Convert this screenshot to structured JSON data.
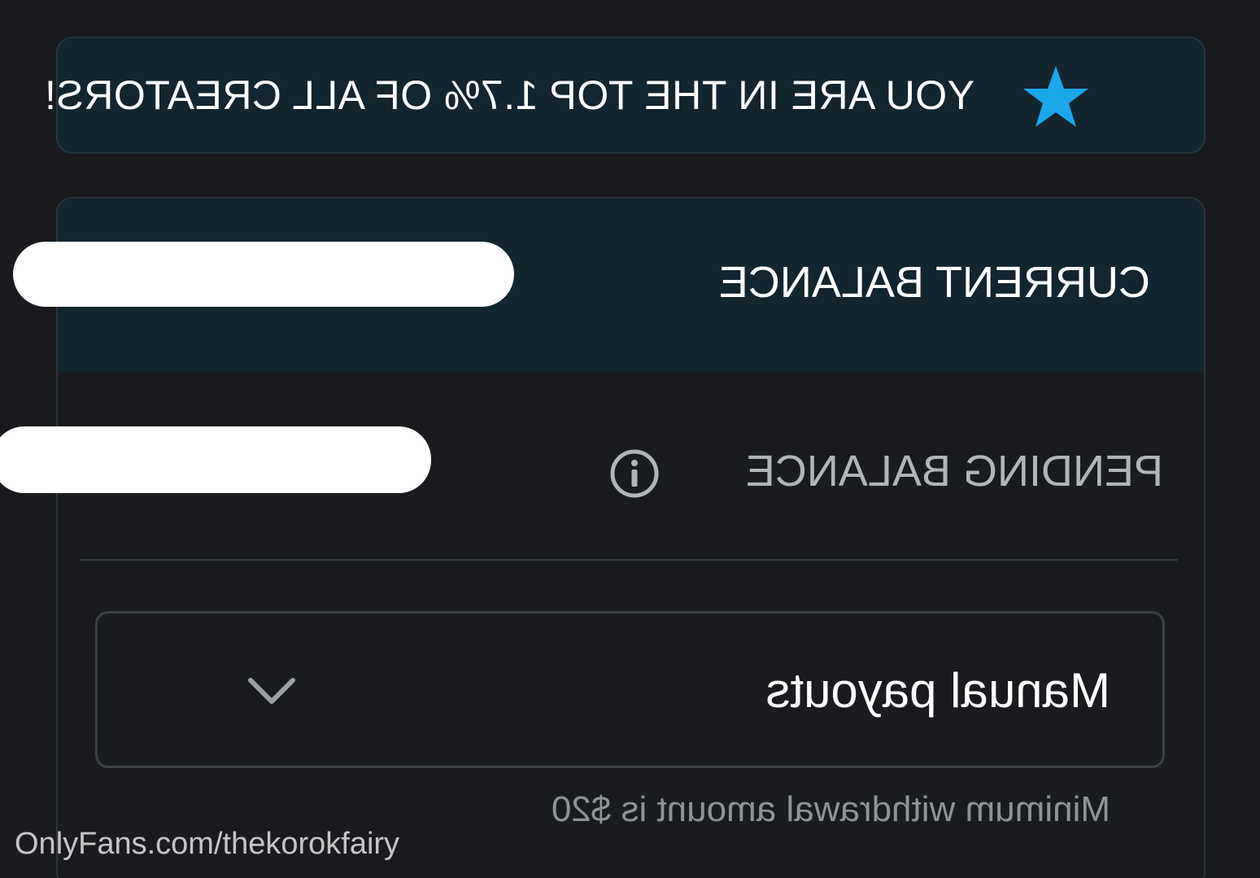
{
  "banner": {
    "text": "YOU ARE IN THE TOP 1.7% OF ALL CREATORS!",
    "icon": "star-icon",
    "icon_color": "#1aa7ec"
  },
  "balances": {
    "current_label": "CURRENT BALANCE",
    "pending_label": "PENDING BALANCE",
    "pending_info_icon": "info-icon"
  },
  "payout": {
    "selected": "Manual payouts",
    "dropdown_icon": "chevron-down-icon",
    "helper": "Minimum withdrawal amount is $20"
  },
  "watermark": "OnlyFans.com/thekorokfairy",
  "colors": {
    "background": "#1a1b1e",
    "banner_bg": "#13252e",
    "accent": "#1aa7ec"
  }
}
